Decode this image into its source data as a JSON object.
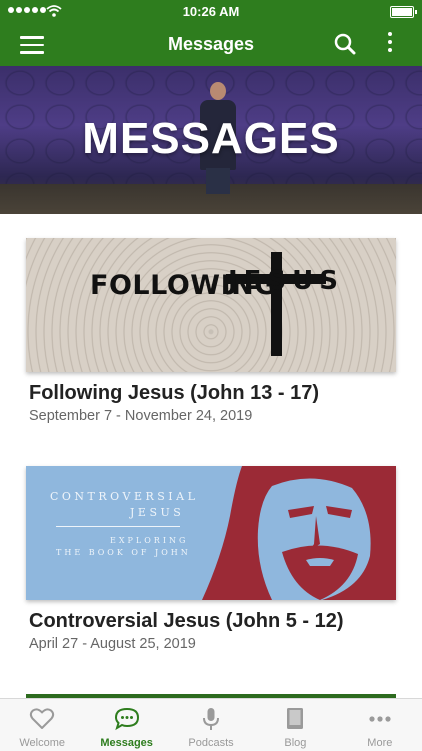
{
  "status_bar": {
    "time": "10:26 AM"
  },
  "nav": {
    "title": "Messages",
    "menu_icon": "hamburger-menu-icon",
    "search_icon": "search-icon",
    "more_icon": "more-vertical-icon"
  },
  "hero": {
    "title": "MESSAGES"
  },
  "series": [
    {
      "title": "Following Jesus (John 13 - 17)",
      "dates": "September 7 - November 24, 2019",
      "art_text": "FOLLOWING",
      "art_text2": "JESUS"
    },
    {
      "title": "Controversial Jesus (John 5 - 12)",
      "dates": "April 27 - August 25, 2019",
      "art_line1": "CONTROVERSIAL",
      "art_line2": "JESUS",
      "art_line3": "EXPLORING",
      "art_line4": "THE BOOK OF JOHN"
    }
  ],
  "tabs": [
    {
      "label": "Welcome",
      "icon": "heart-icon",
      "active": false
    },
    {
      "label": "Messages",
      "icon": "chat-bubble-icon",
      "active": true
    },
    {
      "label": "Podcasts",
      "icon": "microphone-icon",
      "active": false
    },
    {
      "label": "Blog",
      "icon": "book-icon",
      "active": false
    },
    {
      "label": "More",
      "icon": "ellipsis-icon",
      "active": false
    }
  ],
  "colors": {
    "brand_green": "#2e7d1e",
    "tab_inactive": "#999999",
    "art_blue": "#8fb7dd",
    "art_red": "#9b2a36"
  }
}
